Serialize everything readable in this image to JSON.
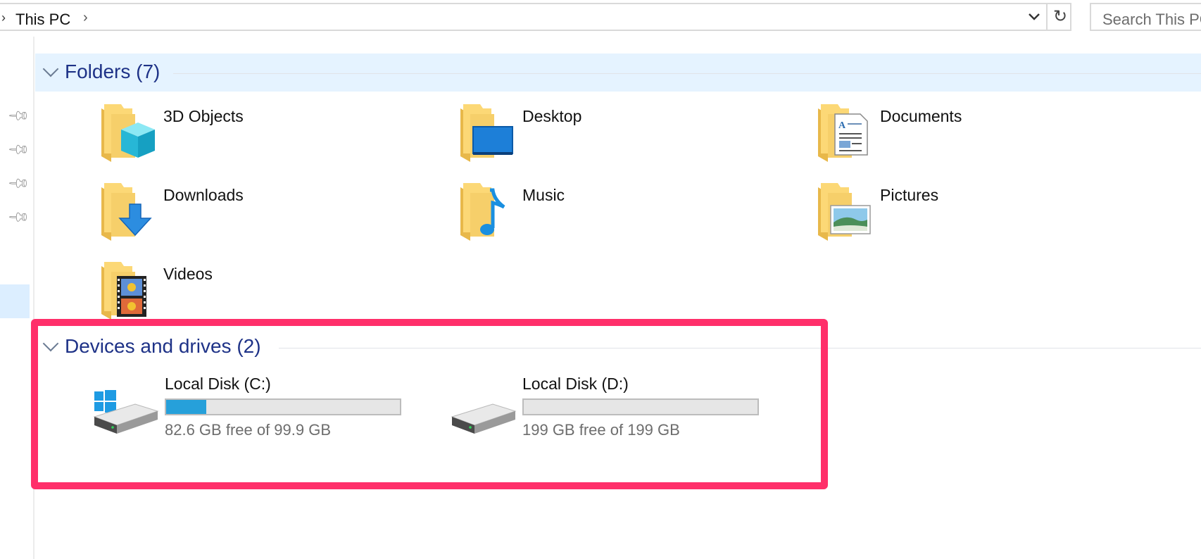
{
  "address_bar": {
    "crumb": "This PC",
    "chevron": "›",
    "dropdown_icon": "chevron-down-icon",
    "refresh_icon": "refresh-icon"
  },
  "search": {
    "placeholder": "Search This PC"
  },
  "groups": {
    "folders": {
      "title": "Folders (7)",
      "items": [
        {
          "label": "3D Objects",
          "icon": "3d-objects-folder-icon"
        },
        {
          "label": "Desktop",
          "icon": "desktop-folder-icon"
        },
        {
          "label": "Documents",
          "icon": "documents-folder-icon"
        },
        {
          "label": "Downloads",
          "icon": "downloads-folder-icon"
        },
        {
          "label": "Music",
          "icon": "music-folder-icon"
        },
        {
          "label": "Pictures",
          "icon": "pictures-folder-icon"
        },
        {
          "label": "Videos",
          "icon": "videos-folder-icon"
        }
      ]
    },
    "devices": {
      "title": "Devices and drives (2)",
      "items": [
        {
          "label": "Local Disk (C:)",
          "space": "82.6 GB free of 99.9 GB",
          "used_fraction": 0.173,
          "icon": "system-drive-icon"
        },
        {
          "label": "Local Disk (D:)",
          "space": "199 GB free of 199 GB",
          "used_fraction": 0.0,
          "icon": "drive-icon"
        }
      ]
    }
  },
  "colors": {
    "group_title": "#1e3287",
    "folders_header_bg": "#e5f3ff",
    "usage_bar": "#26a0da",
    "highlight": "#ff2f6a"
  }
}
